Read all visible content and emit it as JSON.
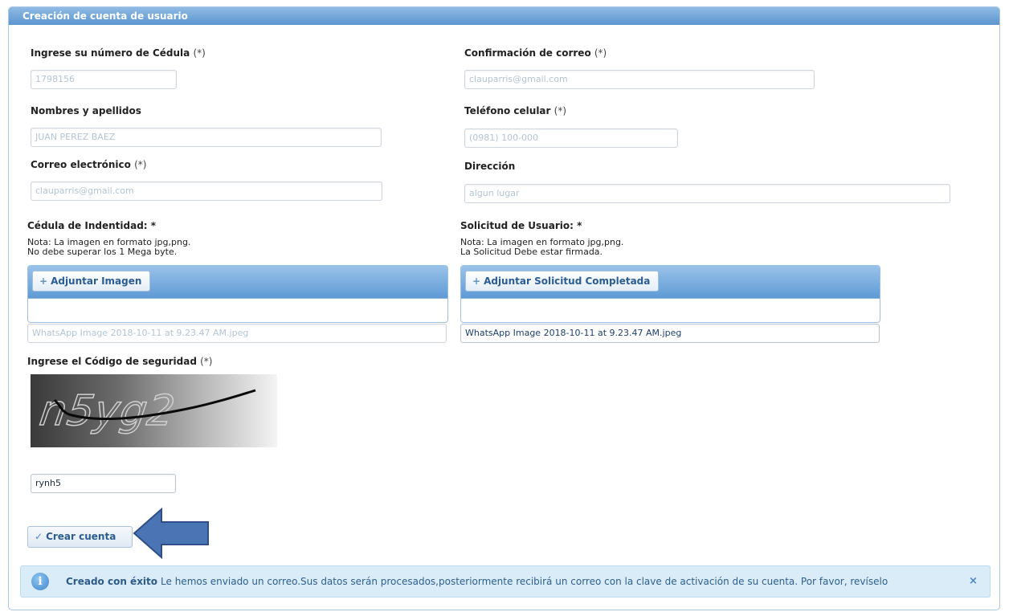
{
  "panel": {
    "title": "Creación de cuenta de usuario"
  },
  "form": {
    "cedula": {
      "label": "Ingrese su número de Cédula",
      "req": "(*)",
      "value": "1798156"
    },
    "nombres": {
      "label": "Nombres y apellidos",
      "value": "JUAN  PEREZ BAEZ"
    },
    "correo": {
      "label": "Correo electrónico",
      "req": "(*)",
      "value": "clauparris@gmail.com"
    },
    "confirmacion": {
      "label": "Confirmación de correo",
      "req": "(*)",
      "value": "clauparris@gmail.com"
    },
    "telefono": {
      "label": "Teléfono celular",
      "req": "(*)",
      "value": "(0981) 100-000"
    },
    "direccion": {
      "label": "Dirección",
      "value": "algun lugar"
    }
  },
  "upload_cedula": {
    "label": "Cédula de Indentidad: *",
    "note1": "Nota: La imagen en formato jpg,png.",
    "note2": "No debe superar los 1 Mega byte.",
    "button": "Adjuntar Imagen",
    "filename": "WhatsApp Image 2018-10-11 at 9.23.47 AM.jpeg"
  },
  "upload_solicitud": {
    "label": "Solicitud de Usuario: *",
    "note1": "Nota: La imagen en formato jpg,png.",
    "note2": "La Solicitud Debe estar firmada.",
    "button": "Adjuntar Solicitud Completada",
    "filename": "WhatsApp Image 2018-10-11 at 9.23.47 AM.jpeg"
  },
  "captcha": {
    "label": "Ingrese el Código de seguridad",
    "req": "(*)",
    "image_text": "n5yg2",
    "value": "rynh5"
  },
  "actions": {
    "create_label": "Crear cuenta"
  },
  "alert": {
    "title": "Creado con éxito",
    "message": "Le hemos enviado un correo.Sus datos serán procesados,posteriormente recibirá un correo con la clave de activación de su cuenta. Por favor, revíselo",
    "close": "×"
  },
  "icons": [
    "plus-icon",
    "check-icon",
    "info-icon",
    "close-icon",
    "arrow-icon"
  ],
  "colors": {
    "header": "#5b95cf",
    "alert_bg": "#d9ecf8",
    "arrow": "#4a74b4"
  }
}
